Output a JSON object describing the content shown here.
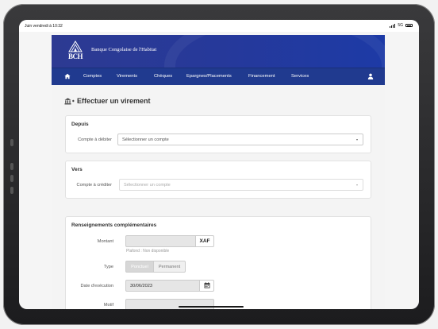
{
  "status": {
    "time": "Juin vendredi à 10:32",
    "network": "5G"
  },
  "header": {
    "logo_text": "BCH",
    "bank_name": "Banque Congolaise de l'Habitat"
  },
  "nav": {
    "items": [
      {
        "label": "Comptes"
      },
      {
        "label": "Virements"
      },
      {
        "label": "Chèques"
      },
      {
        "label": "Epargnes/Placements"
      },
      {
        "label": "Financement"
      },
      {
        "label": "Services"
      }
    ]
  },
  "page": {
    "title": "Effectuer un virement"
  },
  "depuis": {
    "title": "Depuis",
    "account_label": "Compte à débiter",
    "account_value": "Sélectionner un compte"
  },
  "vers": {
    "title": "Vers",
    "account_label": "Compte à créditer",
    "account_value": "Sélectionner un compte"
  },
  "info": {
    "title": "Renseignements complémentaires",
    "amount_label": "Montant",
    "amount_value": "",
    "currency": "XAF",
    "ceiling_hint": "Plafond : Non disponible",
    "type_label": "Type",
    "type_options": [
      "Ponctuel",
      "Permanent"
    ],
    "date_label": "Date d'exécution",
    "date_value": "30/06/2023",
    "motif_label": "Motif",
    "motif_value": ""
  },
  "colors": {
    "banner": "#26399a",
    "navbar": "#203a8f"
  }
}
